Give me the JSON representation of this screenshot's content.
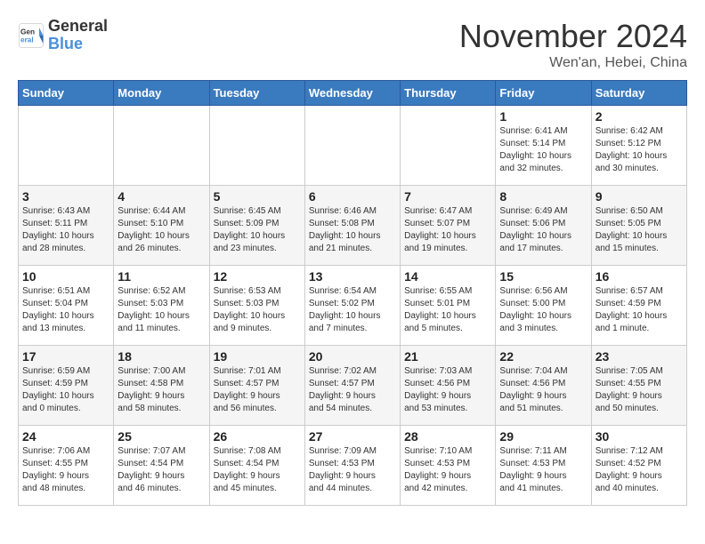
{
  "logo": {
    "line1": "General",
    "line2": "Blue"
  },
  "title": "November 2024",
  "location": "Wen'an, Hebei, China",
  "days_of_week": [
    "Sunday",
    "Monday",
    "Tuesday",
    "Wednesday",
    "Thursday",
    "Friday",
    "Saturday"
  ],
  "weeks": [
    [
      {
        "day": "",
        "info": ""
      },
      {
        "day": "",
        "info": ""
      },
      {
        "day": "",
        "info": ""
      },
      {
        "day": "",
        "info": ""
      },
      {
        "day": "",
        "info": ""
      },
      {
        "day": "1",
        "info": "Sunrise: 6:41 AM\nSunset: 5:14 PM\nDaylight: 10 hours\nand 32 minutes."
      },
      {
        "day": "2",
        "info": "Sunrise: 6:42 AM\nSunset: 5:12 PM\nDaylight: 10 hours\nand 30 minutes."
      }
    ],
    [
      {
        "day": "3",
        "info": "Sunrise: 6:43 AM\nSunset: 5:11 PM\nDaylight: 10 hours\nand 28 minutes."
      },
      {
        "day": "4",
        "info": "Sunrise: 6:44 AM\nSunset: 5:10 PM\nDaylight: 10 hours\nand 26 minutes."
      },
      {
        "day": "5",
        "info": "Sunrise: 6:45 AM\nSunset: 5:09 PM\nDaylight: 10 hours\nand 23 minutes."
      },
      {
        "day": "6",
        "info": "Sunrise: 6:46 AM\nSunset: 5:08 PM\nDaylight: 10 hours\nand 21 minutes."
      },
      {
        "day": "7",
        "info": "Sunrise: 6:47 AM\nSunset: 5:07 PM\nDaylight: 10 hours\nand 19 minutes."
      },
      {
        "day": "8",
        "info": "Sunrise: 6:49 AM\nSunset: 5:06 PM\nDaylight: 10 hours\nand 17 minutes."
      },
      {
        "day": "9",
        "info": "Sunrise: 6:50 AM\nSunset: 5:05 PM\nDaylight: 10 hours\nand 15 minutes."
      }
    ],
    [
      {
        "day": "10",
        "info": "Sunrise: 6:51 AM\nSunset: 5:04 PM\nDaylight: 10 hours\nand 13 minutes."
      },
      {
        "day": "11",
        "info": "Sunrise: 6:52 AM\nSunset: 5:03 PM\nDaylight: 10 hours\nand 11 minutes."
      },
      {
        "day": "12",
        "info": "Sunrise: 6:53 AM\nSunset: 5:03 PM\nDaylight: 10 hours\nand 9 minutes."
      },
      {
        "day": "13",
        "info": "Sunrise: 6:54 AM\nSunset: 5:02 PM\nDaylight: 10 hours\nand 7 minutes."
      },
      {
        "day": "14",
        "info": "Sunrise: 6:55 AM\nSunset: 5:01 PM\nDaylight: 10 hours\nand 5 minutes."
      },
      {
        "day": "15",
        "info": "Sunrise: 6:56 AM\nSunset: 5:00 PM\nDaylight: 10 hours\nand 3 minutes."
      },
      {
        "day": "16",
        "info": "Sunrise: 6:57 AM\nSunset: 4:59 PM\nDaylight: 10 hours\nand 1 minute."
      }
    ],
    [
      {
        "day": "17",
        "info": "Sunrise: 6:59 AM\nSunset: 4:59 PM\nDaylight: 10 hours\nand 0 minutes."
      },
      {
        "day": "18",
        "info": "Sunrise: 7:00 AM\nSunset: 4:58 PM\nDaylight: 9 hours\nand 58 minutes."
      },
      {
        "day": "19",
        "info": "Sunrise: 7:01 AM\nSunset: 4:57 PM\nDaylight: 9 hours\nand 56 minutes."
      },
      {
        "day": "20",
        "info": "Sunrise: 7:02 AM\nSunset: 4:57 PM\nDaylight: 9 hours\nand 54 minutes."
      },
      {
        "day": "21",
        "info": "Sunrise: 7:03 AM\nSunset: 4:56 PM\nDaylight: 9 hours\nand 53 minutes."
      },
      {
        "day": "22",
        "info": "Sunrise: 7:04 AM\nSunset: 4:56 PM\nDaylight: 9 hours\nand 51 minutes."
      },
      {
        "day": "23",
        "info": "Sunrise: 7:05 AM\nSunset: 4:55 PM\nDaylight: 9 hours\nand 50 minutes."
      }
    ],
    [
      {
        "day": "24",
        "info": "Sunrise: 7:06 AM\nSunset: 4:55 PM\nDaylight: 9 hours\nand 48 minutes."
      },
      {
        "day": "25",
        "info": "Sunrise: 7:07 AM\nSunset: 4:54 PM\nDaylight: 9 hours\nand 46 minutes."
      },
      {
        "day": "26",
        "info": "Sunrise: 7:08 AM\nSunset: 4:54 PM\nDaylight: 9 hours\nand 45 minutes."
      },
      {
        "day": "27",
        "info": "Sunrise: 7:09 AM\nSunset: 4:53 PM\nDaylight: 9 hours\nand 44 minutes."
      },
      {
        "day": "28",
        "info": "Sunrise: 7:10 AM\nSunset: 4:53 PM\nDaylight: 9 hours\nand 42 minutes."
      },
      {
        "day": "29",
        "info": "Sunrise: 7:11 AM\nSunset: 4:53 PM\nDaylight: 9 hours\nand 41 minutes."
      },
      {
        "day": "30",
        "info": "Sunrise: 7:12 AM\nSunset: 4:52 PM\nDaylight: 9 hours\nand 40 minutes."
      }
    ]
  ]
}
